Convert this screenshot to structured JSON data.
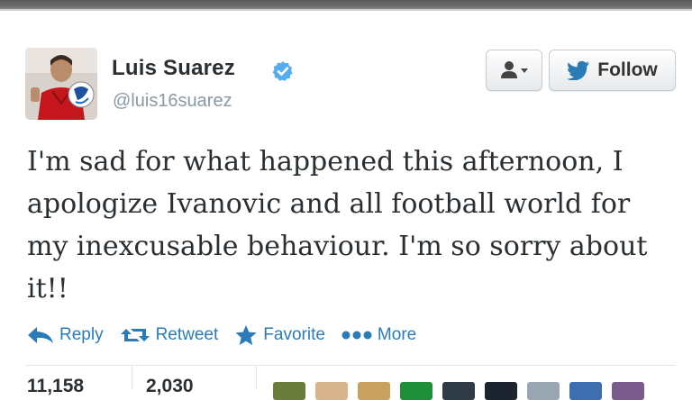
{
  "header": {
    "name": "Luis Suarez",
    "handle": "@luis16suarez",
    "verified_icon": "verified-badge-icon",
    "follow_label": "Follow",
    "accent_color": "#2b7bb9"
  },
  "tweet": {
    "text": "I'm sad for what happened this afternoon, I apologize Ivanovic and all football world for my inexcusable behaviour. I'm so sorry about it!!"
  },
  "actions": {
    "reply": "Reply",
    "retweet": "Retweet",
    "favorite": "Favorite",
    "more": "More"
  },
  "stats": {
    "retweets": "11,158",
    "favorites": "2,030"
  }
}
